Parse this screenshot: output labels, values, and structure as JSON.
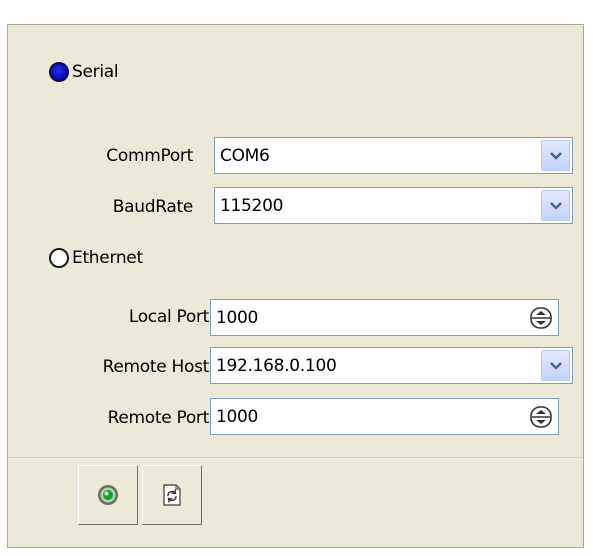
{
  "connection": {
    "serial": {
      "label": "Serial",
      "selected": true
    },
    "ethernet": {
      "label": "Ethernet",
      "selected": false
    }
  },
  "serial_settings": {
    "commport": {
      "label": "CommPort",
      "value": "COM6"
    },
    "baudrate": {
      "label": "BaudRate",
      "value": "115200"
    }
  },
  "ethernet_settings": {
    "local_port": {
      "label": "Local Port",
      "value": "1000"
    },
    "remote_host": {
      "label": "Remote Host",
      "value": "192.168.0.100"
    },
    "remote_port": {
      "label": "Remote Port",
      "value": "1000"
    }
  },
  "toolbar": {
    "connect_icon": "connect-icon",
    "refresh_icon": "refresh-icon"
  },
  "colors": {
    "panel_bg": "#ece9d8",
    "radio_selected": "#1010c8",
    "dropdown_button": "#c3d3fd"
  }
}
